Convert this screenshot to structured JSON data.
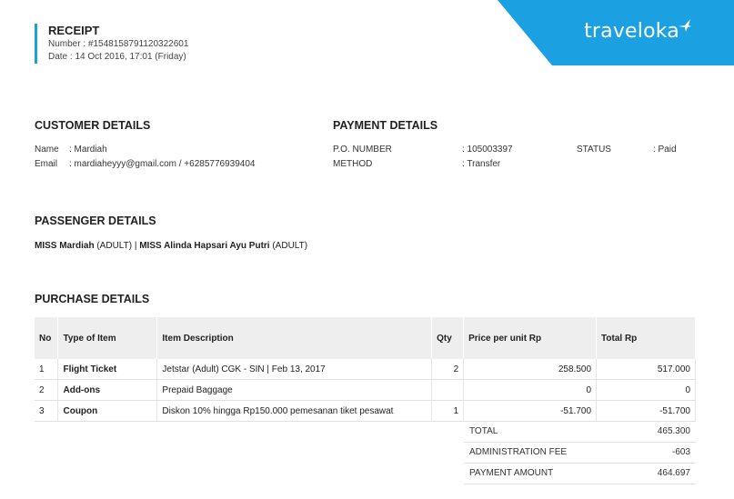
{
  "receipt": {
    "title": "RECEIPT",
    "number": "Number : #1548158791120322601",
    "date": "Date : 14 Oct 2016, 17:01 (Friday)"
  },
  "brand": {
    "name": "traveloka",
    "color": "#1ba0e2"
  },
  "customer": {
    "title": "CUSTOMER DETAILS",
    "name_label": "Name",
    "name_value": ": Mardiah",
    "email_label": "Email",
    "email_value": ": mardiaheyyy@gmail.com / +6285776939404"
  },
  "payment": {
    "title": "PAYMENT DETAILS",
    "po_label": "P.O. NUMBER",
    "po_value": ": 105003397",
    "method_label": "METHOD",
    "method_value": ": Transfer",
    "status_label": "STATUS",
    "status_value": ": Paid"
  },
  "passenger": {
    "title": "PASSENGER DETAILS",
    "p1_name": "MISS Mardiah",
    "p1_type": " (ADULT) | ",
    "p2_name": "MISS Alinda Hapsari Ayu Putri",
    "p2_type": " (ADULT)"
  },
  "purchase": {
    "title": "PURCHASE DETAILS",
    "headers": {
      "no": "No",
      "type": "Type of Item",
      "desc": "Item Description",
      "qty": "Qty",
      "price": "Price per unit Rp",
      "total": "Total Rp"
    },
    "rows": [
      {
        "no": "1",
        "type": "Flight Ticket",
        "desc": "Jetstar (Adult) CGK - SIN | Feb 13, 2017",
        "qty": "2",
        "price": "258.500",
        "total": "517.000"
      },
      {
        "no": "2",
        "type": "Add-ons",
        "desc": "Prepaid Baggage",
        "qty": "",
        "price": "0",
        "total": "0"
      },
      {
        "no": "3",
        "type": "Coupon",
        "desc": "Diskon 10% hingga Rp150.000 pemesanan tiket pesawat",
        "qty": "1",
        "price": "-51.700",
        "total": "-51.700"
      }
    ],
    "summary": {
      "total_label": "TOTAL",
      "total_value": "465.300",
      "admin_label": "ADMINISTRATION FEE",
      "admin_value": "-603",
      "payment_label": "PAYMENT AMOUNT",
      "payment_value": "464.697"
    }
  }
}
